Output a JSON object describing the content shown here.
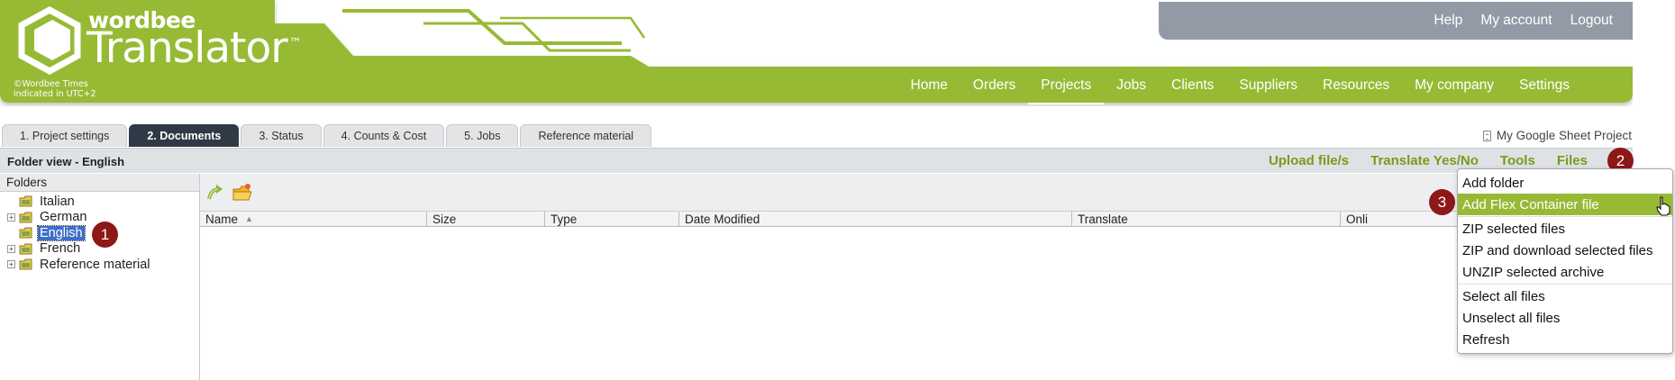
{
  "header": {
    "brand_small": "wordbee",
    "brand_big": "Translator",
    "trademark": "™",
    "copyright_note": "©Wordbee     Times indicated in UTC+2",
    "top_links": [
      "Help",
      "My account",
      "Logout"
    ],
    "main_nav": [
      {
        "label": "Home",
        "active": false
      },
      {
        "label": "Orders",
        "active": false
      },
      {
        "label": "Projects",
        "active": true
      },
      {
        "label": "Jobs",
        "active": false
      },
      {
        "label": "Clients",
        "active": false
      },
      {
        "label": "Suppliers",
        "active": false
      },
      {
        "label": "Resources",
        "active": false
      },
      {
        "label": "My company",
        "active": false
      },
      {
        "label": "Settings",
        "active": false
      }
    ]
  },
  "tabs": [
    {
      "label": "1. Project settings",
      "active": false
    },
    {
      "label": "2. Documents",
      "active": true
    },
    {
      "label": "3. Status",
      "active": false
    },
    {
      "label": "4. Counts & Cost",
      "active": false
    },
    {
      "label": "5. Jobs",
      "active": false
    },
    {
      "label": "Reference material",
      "active": false
    }
  ],
  "project_name": "My Google Sheet Project",
  "toolbar": {
    "title": "Folder view - English",
    "actions": [
      "Upload file/s",
      "Translate Yes/No",
      "Tools",
      "Files"
    ]
  },
  "folders": {
    "header": "Folders",
    "items": [
      {
        "label": "Italian",
        "expandable": false,
        "selected": false
      },
      {
        "label": "German",
        "expandable": true,
        "selected": false
      },
      {
        "label": "English",
        "expandable": false,
        "selected": true
      },
      {
        "label": "French",
        "expandable": true,
        "selected": false
      },
      {
        "label": "Reference material",
        "expandable": true,
        "selected": false
      }
    ]
  },
  "grid": {
    "columns": [
      "Name",
      "Size",
      "Type",
      "Date Modified",
      "Translate",
      "Onli"
    ]
  },
  "files_menu": {
    "items": [
      {
        "label": "Add folder",
        "highlight": false
      },
      {
        "label": "Add Flex Container file",
        "highlight": true
      },
      {
        "sep": true
      },
      {
        "label": "ZIP selected files",
        "highlight": false
      },
      {
        "label": "ZIP and download selected files",
        "highlight": false
      },
      {
        "label": "UNZIP selected archive",
        "highlight": false
      },
      {
        "sep": true
      },
      {
        "label": "Select all files",
        "highlight": false
      },
      {
        "label": "Unselect all files",
        "highlight": false
      },
      {
        "label": "Refresh",
        "highlight": false
      }
    ]
  },
  "callouts": [
    "1",
    "2",
    "3"
  ],
  "colors": {
    "brand_green": "#97ba36",
    "action_green": "#7a9a1b",
    "top_bar_gray": "#929ba5",
    "active_tab": "#2f3a46",
    "callout_red": "#8e1717",
    "selection_blue": "#3c6fc7"
  },
  "icons": {
    "logo": "hexagon-logo-icon",
    "up": "folder-up-icon",
    "new_folder": "new-folder-icon",
    "folder": "folder-icon",
    "cursor": "hand-pointer-icon"
  }
}
